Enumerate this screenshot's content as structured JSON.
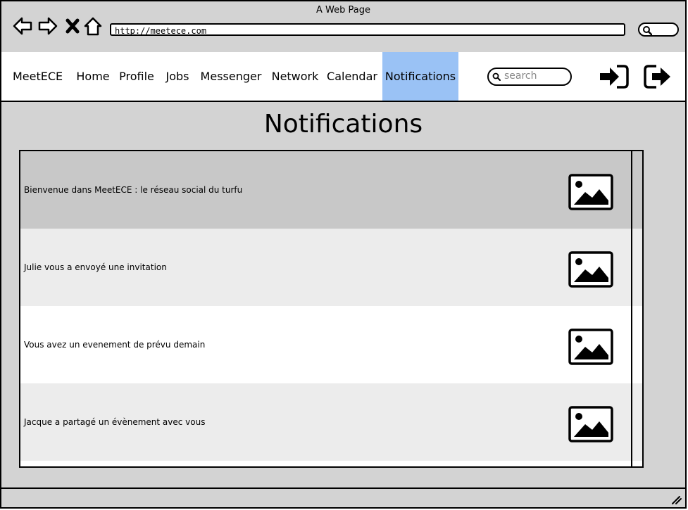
{
  "window": {
    "title": "A Web Page"
  },
  "address_bar": {
    "url": "http://meetece.com"
  },
  "navbar": {
    "brand": "MeetECE",
    "items": [
      {
        "label": "Home",
        "active": false
      },
      {
        "label": "Profile",
        "active": false
      },
      {
        "label": "Jobs",
        "active": false
      },
      {
        "label": "Messenger",
        "active": false
      },
      {
        "label": "Network",
        "active": false
      },
      {
        "label": "Calendar",
        "active": false
      },
      {
        "label": "Notifications",
        "active": true
      }
    ],
    "search": {
      "placeholder": "search"
    },
    "icons": [
      "login-icon",
      "logout-icon"
    ]
  },
  "page": {
    "title": "Notifications"
  },
  "notifications": [
    {
      "text": "Bienvenue dans MeetECE : le réseau social du turfu",
      "icon": "image-icon"
    },
    {
      "text": "Julie vous a  envoyé une invitation",
      "icon": "image-icon"
    },
    {
      "text": "Vous avez un evenement de prévu demain",
      "icon": "image-icon"
    },
    {
      "text": "Jacque a partagé un évènement avec vous",
      "icon": "image-icon"
    }
  ],
  "colors": {
    "chrome": "#d3d3d3",
    "active_tab": "#9ac2f5",
    "row_selected": "#c8c8c8",
    "row_alt": "#ececec",
    "row_plain": "#ffffff"
  }
}
